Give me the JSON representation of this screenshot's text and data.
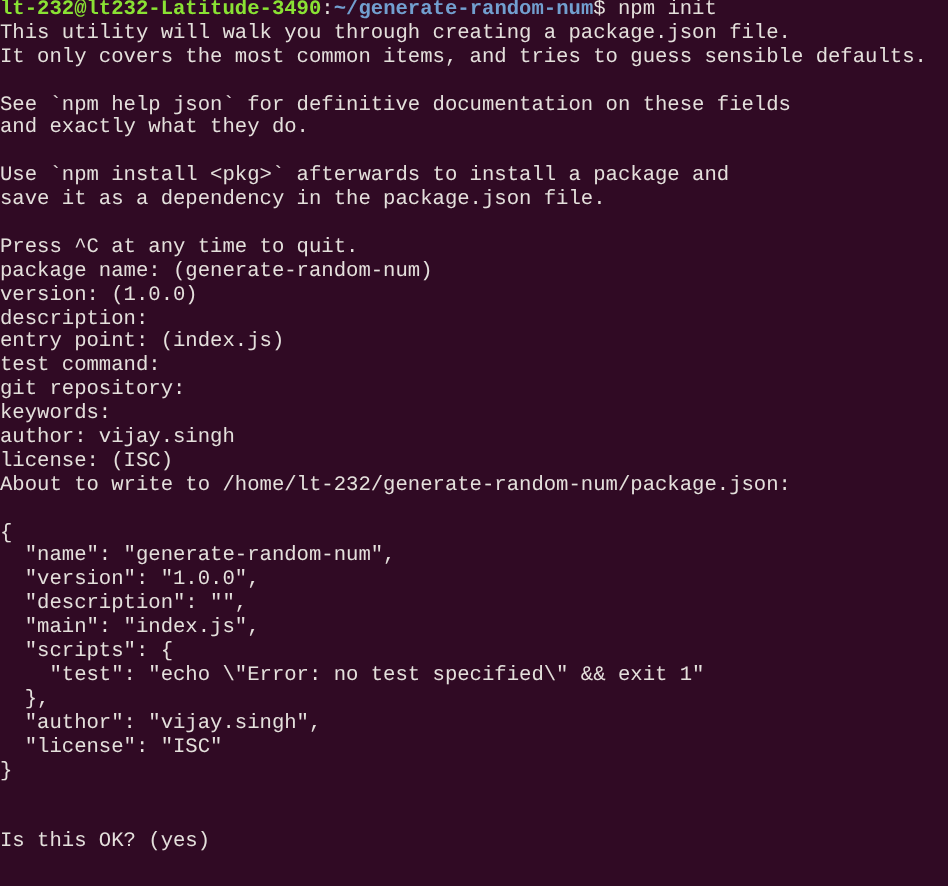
{
  "terminal": {
    "lines": [
      {
        "kind": "prompt",
        "user_host": "lt-232@lt232-Latitude-3490",
        "separator": ":",
        "path": "~/generate-random-num",
        "command": "$ npm init"
      },
      {
        "kind": "output",
        "text": "This utility will walk you through creating a package.json file."
      },
      {
        "kind": "output",
        "text": "It only covers the most common items, and tries to guess sensible defaults."
      },
      {
        "kind": "blank"
      },
      {
        "kind": "output",
        "text": "See `npm help json` for definitive documentation on these fields"
      },
      {
        "kind": "output",
        "text": "and exactly what they do."
      },
      {
        "kind": "blank"
      },
      {
        "kind": "output",
        "text": "Use `npm install <pkg>` afterwards to install a package and"
      },
      {
        "kind": "output",
        "text": "save it as a dependency in the package.json file."
      },
      {
        "kind": "blank"
      },
      {
        "kind": "output",
        "text": "Press ^C at any time to quit."
      },
      {
        "kind": "output",
        "text": "package name: (generate-random-num)"
      },
      {
        "kind": "output",
        "text": "version: (1.0.0)"
      },
      {
        "kind": "output",
        "text": "description:"
      },
      {
        "kind": "output",
        "text": "entry point: (index.js)"
      },
      {
        "kind": "output",
        "text": "test command:"
      },
      {
        "kind": "output",
        "text": "git repository:"
      },
      {
        "kind": "output",
        "text": "keywords:"
      },
      {
        "kind": "output",
        "text": "author: vijay.singh"
      },
      {
        "kind": "output",
        "text": "license: (ISC)"
      },
      {
        "kind": "output",
        "text": "About to write to /home/lt-232/generate-random-num/package.json:"
      },
      {
        "kind": "blank"
      },
      {
        "kind": "output",
        "text": "{"
      },
      {
        "kind": "output",
        "text": "  \"name\": \"generate-random-num\","
      },
      {
        "kind": "output",
        "text": "  \"version\": \"1.0.0\","
      },
      {
        "kind": "output",
        "text": "  \"description\": \"\","
      },
      {
        "kind": "output",
        "text": "  \"main\": \"index.js\","
      },
      {
        "kind": "output",
        "text": "  \"scripts\": {"
      },
      {
        "kind": "output",
        "text": "    \"test\": \"echo \\\"Error: no test specified\\\" && exit 1\""
      },
      {
        "kind": "output",
        "text": "  },"
      },
      {
        "kind": "output",
        "text": "  \"author\": \"vijay.singh\","
      },
      {
        "kind": "output",
        "text": "  \"license\": \"ISC\""
      },
      {
        "kind": "output",
        "text": "}"
      },
      {
        "kind": "blank"
      },
      {
        "kind": "blank"
      },
      {
        "kind": "output",
        "text": "Is this OK? (yes)"
      }
    ]
  }
}
